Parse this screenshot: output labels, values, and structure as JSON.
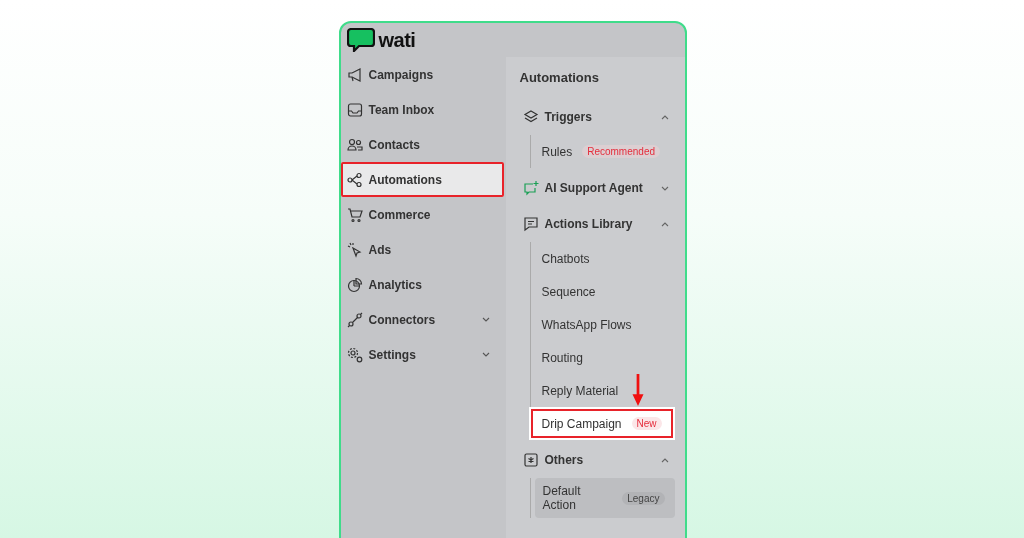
{
  "brand": {
    "name": "wati"
  },
  "nav": [
    {
      "label": "Campaigns",
      "selected": false,
      "highlighted": false,
      "expandable": false
    },
    {
      "label": "Team Inbox",
      "selected": false,
      "highlighted": false,
      "expandable": false
    },
    {
      "label": "Contacts",
      "selected": false,
      "highlighted": false,
      "expandable": false
    },
    {
      "label": "Automations",
      "selected": true,
      "highlighted": true,
      "expandable": false
    },
    {
      "label": "Commerce",
      "selected": false,
      "highlighted": false,
      "expandable": false
    },
    {
      "label": "Ads",
      "selected": false,
      "highlighted": false,
      "expandable": false
    },
    {
      "label": "Analytics",
      "selected": false,
      "highlighted": false,
      "expandable": false
    },
    {
      "label": "Connectors",
      "selected": false,
      "highlighted": false,
      "expandable": true
    },
    {
      "label": "Settings",
      "selected": false,
      "highlighted": false,
      "expandable": true
    }
  ],
  "panel": {
    "title": "Automations",
    "sections": [
      {
        "label": "Triggers",
        "expanded": true,
        "items": [
          {
            "label": "Rules",
            "badge": "Recommended",
            "selected": false,
            "highlighted": false,
            "arrow": false
          }
        ]
      },
      {
        "label": "AI Support Agent",
        "expanded": false
      },
      {
        "label": "Actions Library",
        "expanded": true,
        "items": [
          {
            "label": "Chatbots",
            "selected": false,
            "highlighted": false,
            "arrow": false
          },
          {
            "label": "Sequence",
            "selected": false,
            "highlighted": false,
            "arrow": false
          },
          {
            "label": "WhatsApp Flows",
            "selected": false,
            "highlighted": false,
            "arrow": false
          },
          {
            "label": "Routing",
            "selected": false,
            "highlighted": false,
            "arrow": false
          },
          {
            "label": "Reply Material",
            "selected": false,
            "highlighted": false,
            "arrow": true
          },
          {
            "label": "Drip Campaign",
            "badge": "New",
            "selected": false,
            "highlighted": true,
            "arrow": false
          }
        ]
      },
      {
        "label": "Others",
        "expanded": true,
        "items": [
          {
            "label": "Default Action",
            "badge": "Legacy",
            "selected": true,
            "highlighted": false,
            "arrow": false
          }
        ]
      }
    ]
  }
}
